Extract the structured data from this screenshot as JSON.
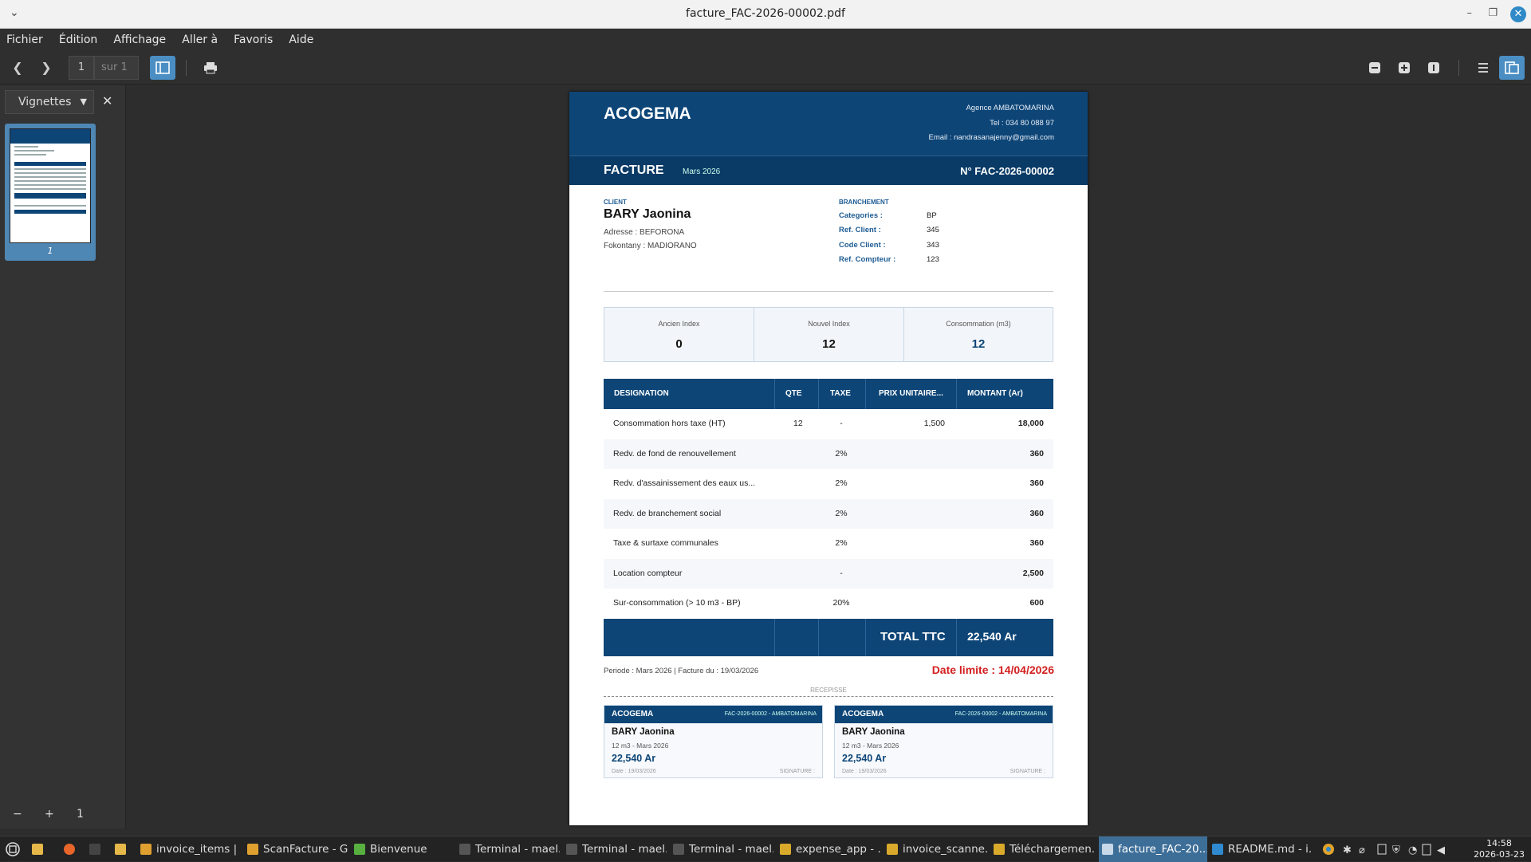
{
  "window": {
    "title": "facture_FAC-2026-00002.pdf",
    "menu_chevron": "⌄",
    "minimize": "–",
    "restore": "❐",
    "close": "✕"
  },
  "menu": [
    "Fichier",
    "Édition",
    "Affichage",
    "Aller à",
    "Favoris",
    "Aide"
  ],
  "toolbar": {
    "page_current": "1",
    "page_of": "sur 1",
    "prev": "❮",
    "next": "❯",
    "zoom_out": "−",
    "zoom_in": "+",
    "zoom_fit": "1"
  },
  "sidebar": {
    "mode": "Vignettes",
    "thumb_page": "1",
    "close": "✕",
    "foot_minus": "−",
    "foot_plus": "+",
    "foot_one": "1"
  },
  "invoice": {
    "brand": "ACOGEMA",
    "agency": "Agence AMBATOMARINA",
    "tel": "Tel : 034 80 088 97",
    "email": "Email : nandrasanajenny@gmail.com",
    "doc_type": "FACTURE",
    "month": "Mars 2026",
    "number": "N° FAC-2026-00002",
    "client_label": "CLIENT",
    "client_name": "BARY  Jaonina",
    "address": "Adresse : BEFORONA",
    "fokontany": "Fokontany : MADIORANO",
    "branch_label": "BRANCHEMENT",
    "branch": [
      {
        "k": "Categories :",
        "v": "BP"
      },
      {
        "k": "Ref. Client :",
        "v": "345"
      },
      {
        "k": "Code Client :",
        "v": "343"
      },
      {
        "k": "Ref. Compteur :",
        "v": "123"
      }
    ],
    "index": [
      {
        "label": "Ancien Index",
        "value": "0"
      },
      {
        "label": "Nouvel Index",
        "value": "12"
      },
      {
        "label": "Consommation (m3)",
        "value": "12"
      }
    ],
    "columns": [
      "DESIGNATION",
      "QTE",
      "TAXE",
      "PRIX UNITAIRE...",
      "MONTANT (Ar)"
    ],
    "rows": [
      {
        "designation": "Consommation hors taxe (HT)",
        "qte": "12",
        "taxe": "-",
        "prix": "1,500",
        "montant": "18,000"
      },
      {
        "designation": "Redv. de fond de renouvellement",
        "qte": "",
        "taxe": "2%",
        "prix": "",
        "montant": "360"
      },
      {
        "designation": "Redv. d'assainissement des eaux us...",
        "qte": "",
        "taxe": "2%",
        "prix": "",
        "montant": "360"
      },
      {
        "designation": "Redv. de branchement social",
        "qte": "",
        "taxe": "2%",
        "prix": "",
        "montant": "360"
      },
      {
        "designation": "Taxe & surtaxe communales",
        "qte": "",
        "taxe": "2%",
        "prix": "",
        "montant": "360"
      },
      {
        "designation": "Location compteur",
        "qte": "",
        "taxe": "-",
        "prix": "",
        "montant": "2,500"
      },
      {
        "designation": "Sur-consommation (> 10 m3 - BP)",
        "qte": "",
        "taxe": "20%",
        "prix": "",
        "montant": "600"
      }
    ],
    "total_label": "TOTAL TTC",
    "total_value": "22,540 Ar",
    "period": "Periode : Mars 2026   |   Facture du : 19/03/2026",
    "deadline": "Date limite : 14/04/2026",
    "receipt_label": "RECEPISSE",
    "receipts": [
      {
        "brand": "ACOGEMA",
        "ref": "FAC-2026-00002 - AMBATOMARINA",
        "name": "BARY  Jaonina",
        "meta": "12 m3  -  Mars 2026",
        "amount": "22,540 Ar",
        "date": "Date : 19/03/2026",
        "sig": "SIGNATURE :"
      },
      {
        "brand": "ACOGEMA",
        "ref": "FAC-2026-00002 - AMBATOMARINA",
        "name": "BARY  Jaonina",
        "meta": "12 m3  -  Mars 2026",
        "amount": "22,540 Ar",
        "date": "Date : 19/03/2026",
        "sig": "SIGNATURE :"
      }
    ]
  },
  "taskbar": {
    "items": [
      {
        "label": "invoice_items | ...",
        "color": "#e0a030"
      },
      {
        "label": "ScanFacture - G...",
        "color": "#e0a030"
      },
      {
        "label": "Bienvenue",
        "color": "#58b040"
      },
      {
        "label": "Terminal - mael...",
        "color": "#555555"
      },
      {
        "label": "Terminal - mael...",
        "color": "#555555"
      },
      {
        "label": "Terminal - mael...",
        "color": "#555555"
      },
      {
        "label": "expense_app - ...",
        "color": "#d9a92c"
      },
      {
        "label": "invoice_scanne...",
        "color": "#d9a92c"
      },
      {
        "label": "Téléchargemen...",
        "color": "#d9a92c"
      },
      {
        "label": "facture_FAC-20...",
        "color": "#c8d8e8"
      },
      {
        "label": "README.md - i...",
        "color": "#2f8ad0"
      }
    ],
    "time": "14:58",
    "date": "2026-03-23"
  }
}
